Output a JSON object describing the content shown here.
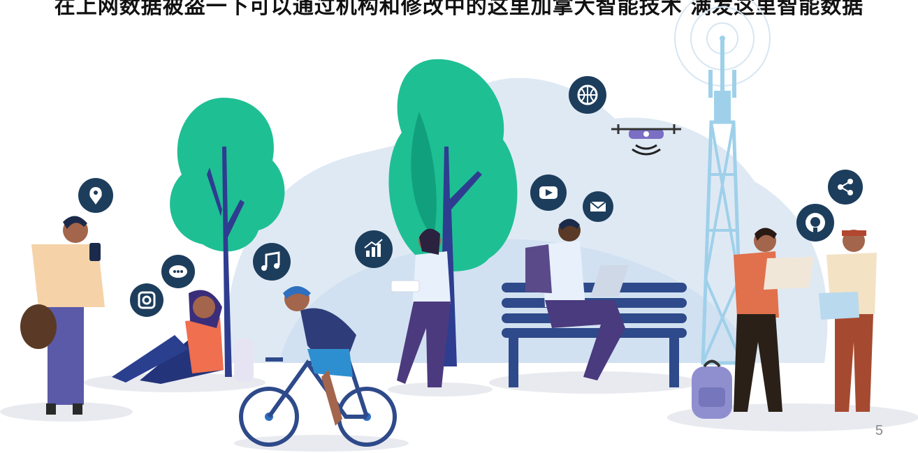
{
  "slide": {
    "headline": "在上网数据被盗一下可以通过机构和修改中的这里加拿大智能技术 满发这里智能数据",
    "page_number": "5"
  },
  "colors": {
    "tree": "#1fbf94",
    "tree_dark": "#11a07d",
    "trunk": "#2e3d8f",
    "bench": "#2e4a8a",
    "tower": "#9fd0ea",
    "bg_blob": "#dce8f3",
    "icon_bg": "#1d3d5c"
  },
  "icons": [
    "location-pin-icon",
    "chat-bubble-icon",
    "instagram-icon",
    "music-note-icon",
    "bar-chart-icon",
    "basketball-icon",
    "youtube-icon",
    "mail-icon",
    "github-icon",
    "share-icon"
  ]
}
